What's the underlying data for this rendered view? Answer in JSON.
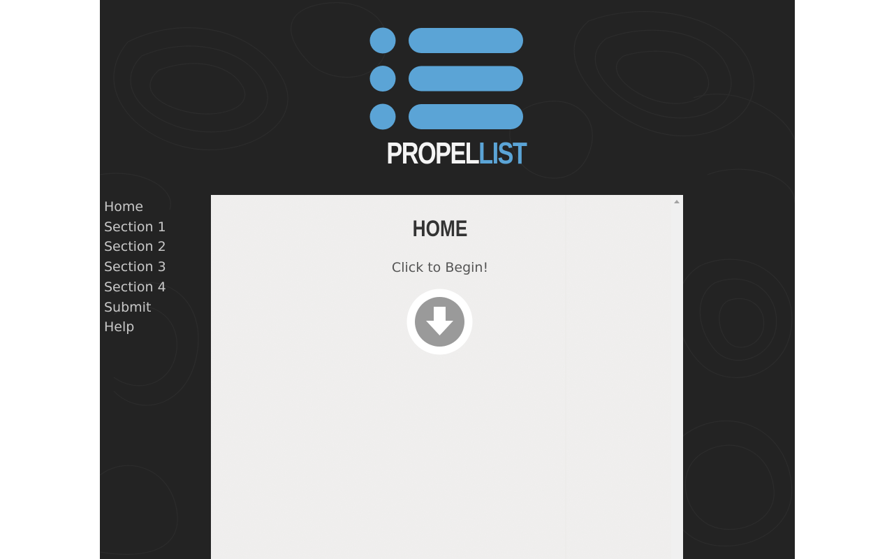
{
  "brand": {
    "wordmark_part1": "PROPEL",
    "wordmark_part2": "LIST",
    "accent_color": "#5ba4d6",
    "logo_icon": "list-icon"
  },
  "nav": {
    "items": [
      {
        "label": "Home"
      },
      {
        "label": "Section 1"
      },
      {
        "label": "Section 2"
      },
      {
        "label": "Section 3"
      },
      {
        "label": "Section 4"
      },
      {
        "label": "Submit"
      },
      {
        "label": "Help"
      }
    ]
  },
  "main": {
    "title": "HOME",
    "subtitle": "Click to Begin!",
    "begin_icon": "arrow-down-circle-icon"
  },
  "colors": {
    "background": "#232323",
    "panel": "#f1f0ef",
    "nav_text": "#c8c8c8",
    "title_text": "#333333",
    "icon_gray": "#9a9a9a"
  }
}
